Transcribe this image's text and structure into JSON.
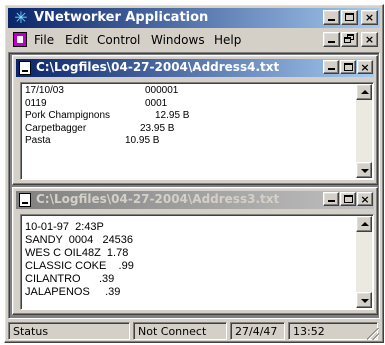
{
  "app": {
    "title": "VNetworker Application",
    "icon": "network-star-icon",
    "accent_color": "#0a246a"
  },
  "menu": {
    "items": [
      "File",
      "Edit",
      "Control",
      "Windows",
      "Help"
    ]
  },
  "caption_buttons": {
    "minimize": "_",
    "maximize": "□",
    "close": "×"
  },
  "windows": [
    {
      "title": "C:\\Logfiles\\04-27-2004\\Address4.txt",
      "active": true,
      "lines": [
        [
          "17/10/03",
          "000001"
        ],
        [
          "0119",
          "0001"
        ],
        [
          "Pork Champignons",
          "12.95 B"
        ],
        [
          "Carpetbagger",
          "23.95 B"
        ],
        [
          "Pasta",
          "10.95 B"
        ]
      ]
    },
    {
      "title": "C:\\Logfiles\\04-27-2004\\Address3.txt",
      "active": false,
      "lines": [
        "10-01-97  2:43P",
        "SANDY  0004   24536",
        "WES C OIL48Z  1.78",
        "CLASSIC COKE    .99",
        "CILANTRO      .39",
        "JALAPENOS     .39"
      ]
    }
  ],
  "status": {
    "label": "Status",
    "connection": "Not Connect",
    "date": "27/4/47",
    "time": "13:52"
  }
}
